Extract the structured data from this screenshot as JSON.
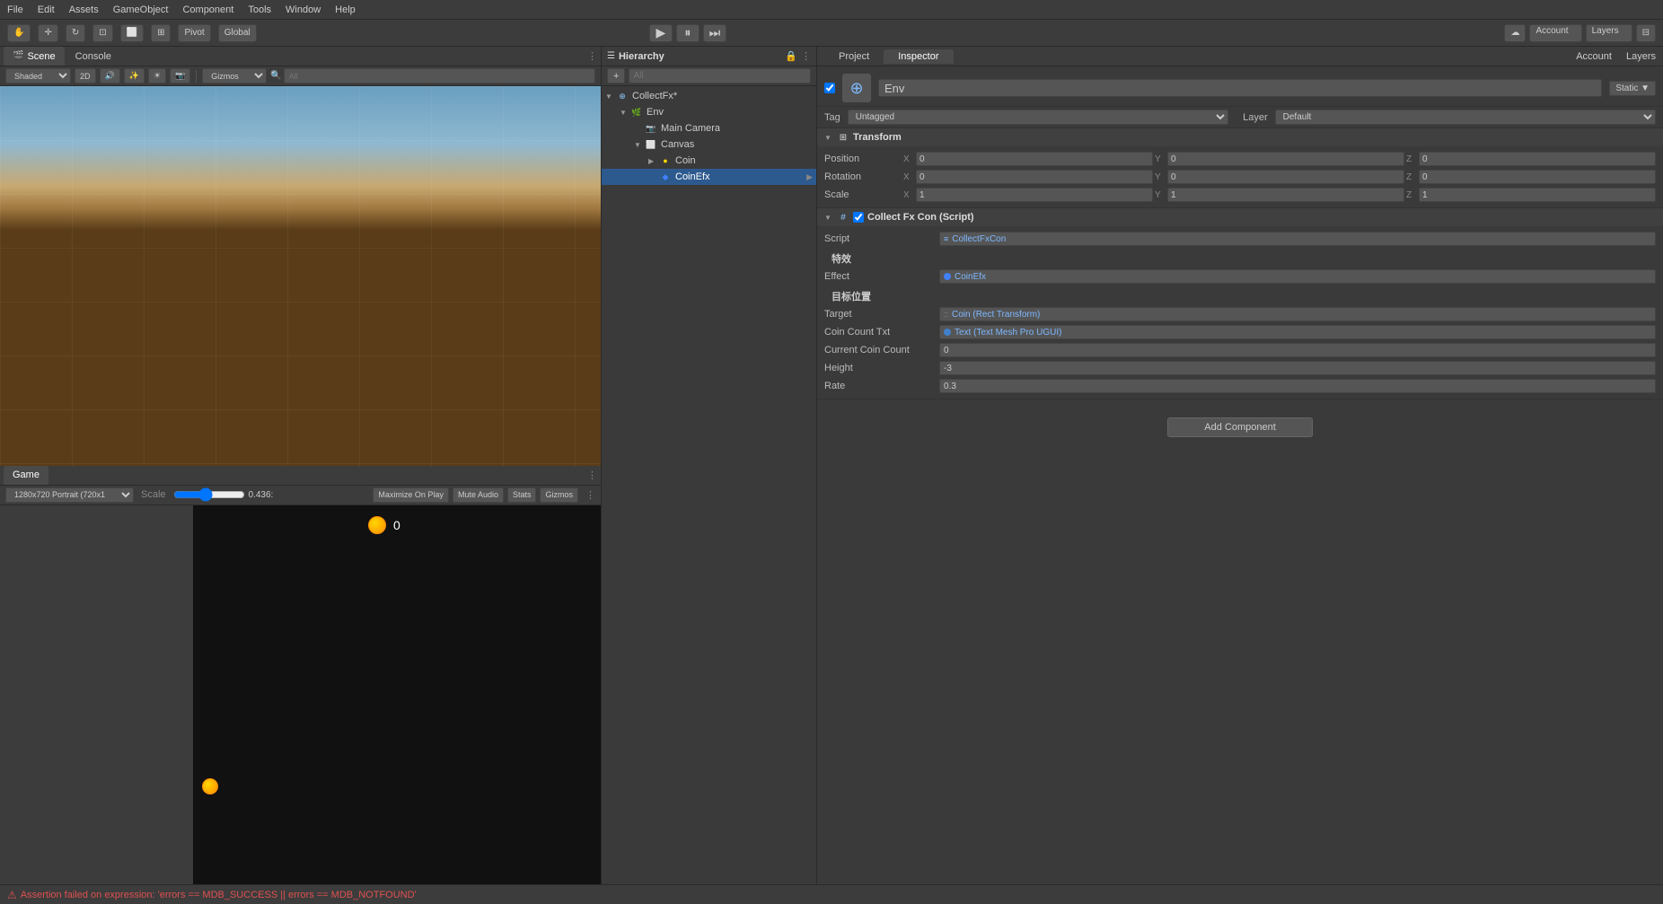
{
  "menubar": {
    "items": [
      "File",
      "Edit",
      "Assets",
      "GameObject",
      "Component",
      "Tools",
      "Window",
      "Help"
    ]
  },
  "toolbar": {
    "pivot_label": "Pivot",
    "global_label": "Global",
    "play_icon": "▶",
    "pause_icon": "⏸",
    "step_icon": "⏭",
    "account_label": "Account",
    "layers_label": "Layers"
  },
  "scene_tab": {
    "label": "Scene",
    "icon": "🎬"
  },
  "console_tab": {
    "label": "Console"
  },
  "scene_toolbar": {
    "shaded_label": "Shaded",
    "mode_2d": "2D",
    "gizmos_label": "Gizmos",
    "search_placeholder": "All"
  },
  "game_tab": {
    "label": "Game"
  },
  "game_toolbar": {
    "resolution_label": "1280x720 Portrait (720x1",
    "scale_label": "Scale",
    "scale_value": "0.436:",
    "maximize_label": "Maximize On Play",
    "mute_label": "Mute Audio",
    "stats_label": "Stats",
    "gizmos_label": "Gizmos"
  },
  "hierarchy": {
    "title": "Hierarchy",
    "search_placeholder": "All",
    "items": [
      {
        "id": "collectfx",
        "label": "CollectFx*",
        "level": 0,
        "hasArrow": true,
        "expanded": true,
        "type": "root"
      },
      {
        "id": "env",
        "label": "Env",
        "level": 1,
        "hasArrow": true,
        "expanded": true,
        "type": "go"
      },
      {
        "id": "maincamera",
        "label": "Main Camera",
        "level": 2,
        "hasArrow": false,
        "type": "camera"
      },
      {
        "id": "canvas",
        "label": "Canvas",
        "level": 2,
        "hasArrow": true,
        "expanded": true,
        "type": "canvas"
      },
      {
        "id": "coin",
        "label": "Coin",
        "level": 3,
        "hasArrow": false,
        "type": "go"
      },
      {
        "id": "coinefx",
        "label": "CoinEfx",
        "level": 3,
        "hasArrow": false,
        "type": "go",
        "selected": true
      }
    ]
  },
  "inspector": {
    "project_tab": "Project",
    "inspector_tab": "Inspector",
    "account_tab": "Account",
    "layers_tab": "Layers",
    "obj_name": "Env",
    "tag_label": "Tag",
    "tag_value": "Untagged",
    "layer_label": "Layer",
    "layer_value": "Default",
    "transform": {
      "title": "Transform",
      "position_label": "Position",
      "position_x": "0",
      "position_y": "0",
      "position_z": "0",
      "rotation_label": "Rotation",
      "rotation_x": "0",
      "rotation_y": "0",
      "rotation_z": "0",
      "scale_label": "Scale",
      "scale_x": "1",
      "scale_y": "1",
      "scale_z": "1"
    },
    "script_component": {
      "title": "Collect Fx Con (Script)",
      "script_label": "Script",
      "script_value": "CollectFxCon",
      "effect_section": "特效",
      "effect_label": "Effect",
      "effect_value": "CoinEfx",
      "target_section": "目标位置",
      "target_label": "Target",
      "target_value": "Coin (Rect Transform)",
      "coin_count_txt_label": "Coin Count Txt",
      "coin_count_txt_value": "Text (Text Mesh Pro UGUI)",
      "current_coin_label": "Current Coin Count",
      "current_coin_value": "0",
      "height_label": "Height",
      "height_value": "-3",
      "rate_label": "Rate",
      "rate_value": "0.3"
    },
    "add_component_label": "Add Component"
  },
  "bottom_bar": {
    "error_message": "Assertion failed on expression: 'errors == MDB_SUCCESS || errors == MDB_NOTFOUND'"
  }
}
